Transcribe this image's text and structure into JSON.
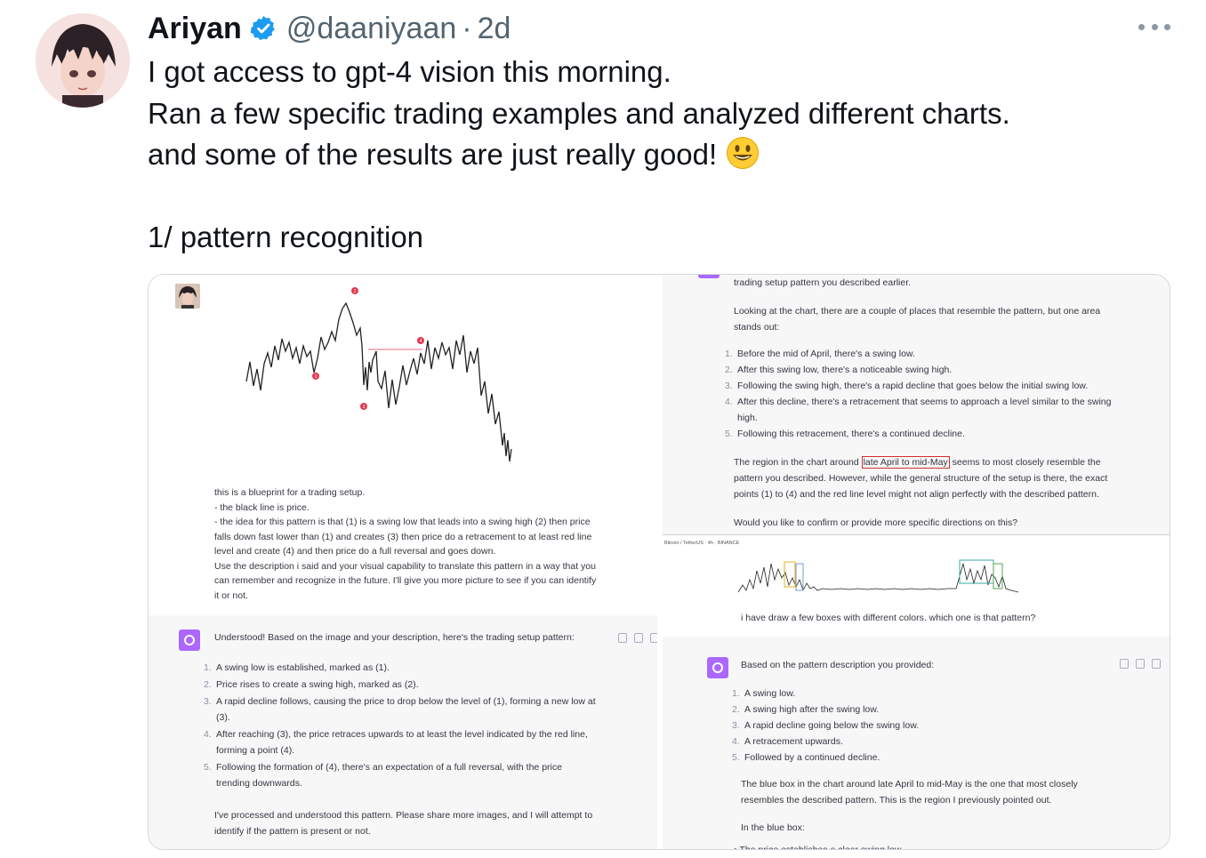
{
  "tweet": {
    "name": "Ariyan",
    "handle": "@daaniyaan",
    "separator": "·",
    "time": "2d",
    "lines": [
      "I got access to gpt-4 vision this morning.",
      "Ran a few specific trading examples and analyzed different charts.",
      "and some of the results are just really good!",
      "1/ pattern recognition"
    ]
  },
  "left": {
    "chart_labels": [
      "2",
      "4",
      "1",
      "3"
    ],
    "user_message": [
      "this is a blueprint for a trading setup.",
      "- the black line is price.",
      "- the idea for this pattern is that (1) is a swing low that leads into a swing high (2) then price",
      "falls down fast lower than (1) and creates (3) then price do a retracement to at least red line",
      "level and create (4) and then price do a full reversal and goes down.",
      "Use the description i said and your visual capability to translate this pattern in a way that you",
      "can remember and recognize in the future. I'll give you more picture to see if you can identify",
      "it or not."
    ],
    "ai_intro": "Understood! Based on the image and your description, here's the trading setup pattern:",
    "ai_list": [
      {
        "num": "1.",
        "lines": [
          "A swing low is established, marked as (1)."
        ]
      },
      {
        "num": "2.",
        "lines": [
          "Price rises to create a swing high, marked as (2)."
        ]
      },
      {
        "num": "3.",
        "lines": [
          "A rapid decline follows, causing the price to drop below the level of (1), forming a new low at",
          "(3)."
        ]
      },
      {
        "num": "4.",
        "lines": [
          "After reaching (3), the price retraces upwards to at least the level indicated by the red line,",
          "forming a point (4)."
        ]
      },
      {
        "num": "5.",
        "lines": [
          "Following the formation of (4), there's an expectation of a full reversal, with the price",
          "trending downwards."
        ]
      }
    ],
    "ai_tail": [
      "I've processed and understood this pattern. Please share more images, and I will attempt to",
      "identify if the pattern is present or not."
    ]
  },
  "right": {
    "p0": "trading setup pattern you described earlier.",
    "p1": [
      "Looking at the chart, there are a couple of places that resemble the pattern, but one area",
      "stands out:"
    ],
    "list": [
      {
        "num": "1.",
        "lines": [
          "Before the mid of April, there's a swing low."
        ]
      },
      {
        "num": "2.",
        "lines": [
          "After this swing low, there's a noticeable swing high."
        ]
      },
      {
        "num": "3.",
        "lines": [
          "Following the swing high, there's a rapid decline that goes below the initial swing low."
        ]
      },
      {
        "num": "4.",
        "lines": [
          "After this decline, there's a retracement that seems to approach a level similar to the swing",
          "high."
        ]
      },
      {
        "num": "5.",
        "lines": [
          "Following this retracement, there's a continued decline."
        ]
      }
    ],
    "p2_before": "The region in the chart around ",
    "p2_highlight": "late April to mid-May",
    "p2_after": " seems to most closely resemble the",
    "p2_lines": [
      "pattern you described. However, while the general structure of the setup is there, the exact",
      "points (1) to (4) and the red line level might not align perfectly with the described pattern."
    ],
    "p3": "Would you like to confirm or provide more specific directions on this?",
    "shot_header": "Bitcoin / TetherUS · 4h · BINANCE",
    "shot_message": "i have draw a few boxes with different colors. which one is that pattern?",
    "ai_intro": "Based on the pattern description you provided:",
    "ai_list": [
      {
        "num": "1.",
        "lines": [
          "A swing low."
        ]
      },
      {
        "num": "2.",
        "lines": [
          "A swing high after the swing low."
        ]
      },
      {
        "num": "3.",
        "lines": [
          "A rapid decline going below the swing low."
        ]
      },
      {
        "num": "4.",
        "lines": [
          "A retracement upwards."
        ]
      },
      {
        "num": "5.",
        "lines": [
          "Followed by a continued decline."
        ]
      }
    ],
    "ai_p1": [
      "The blue box in the chart around late April to mid-May is the one that most closely",
      "resembles the described pattern. This is the region I previously pointed out."
    ],
    "ai_p2": "In the blue box:",
    "ai_bullet": "• The price establishes a clear swing low."
  },
  "colors": {
    "accent": "#1d9bf0",
    "gpt": "#ab68ff",
    "marker": "#e53950",
    "highlight": "#d32f2f"
  },
  "icons": [
    "verified-badge-icon",
    "more-icon",
    "smiley-emoji-icon",
    "chatgpt-icon",
    "copy-icon",
    "thumbs-up-icon",
    "thumbs-down-icon"
  ]
}
